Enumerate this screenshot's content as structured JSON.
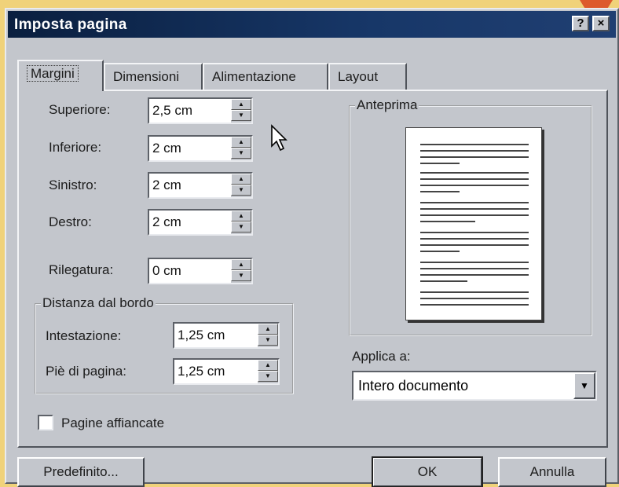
{
  "window": {
    "title": "Imposta pagina",
    "help_glyph": "?",
    "close_glyph": "×"
  },
  "tabs": [
    {
      "label": "Margini"
    },
    {
      "label": "Dimensioni"
    },
    {
      "label": "Alimentazione"
    },
    {
      "label": "Layout"
    }
  ],
  "margins": {
    "superiore": {
      "label": "Superiore:",
      "value": "2,5 cm"
    },
    "inferiore": {
      "label": "Inferiore:",
      "value": "2 cm"
    },
    "sinistro": {
      "label": "Sinistro:",
      "value": "2 cm"
    },
    "destro": {
      "label": "Destro:",
      "value": "2 cm"
    },
    "rilegatura": {
      "label": "Rilegatura:",
      "value": "0 cm"
    }
  },
  "distance": {
    "title": "Distanza dal bordo",
    "intestazione": {
      "label": "Intestazione:",
      "value": "1,25 cm"
    },
    "pie": {
      "label": "Piè di pagina:",
      "value": "1,25 cm"
    }
  },
  "preview": {
    "title": "Anteprima"
  },
  "apply": {
    "label": "Applica a:",
    "value": "Intero documento"
  },
  "checkbox": {
    "label": "Pagine affiancate",
    "checked": false
  },
  "buttons": {
    "default": "Predefinito...",
    "ok": "OK",
    "cancel": "Annulla"
  },
  "colors": {
    "dialog_bg": "#c3c6cc",
    "titlebar": "#0a1f3f",
    "marker": "#dd5a2c",
    "backdrop": "#f0d27a"
  },
  "icons": {
    "spin": "spin-arrows",
    "dropdown": "triangle-down",
    "cursor": "arrow-pointer"
  }
}
